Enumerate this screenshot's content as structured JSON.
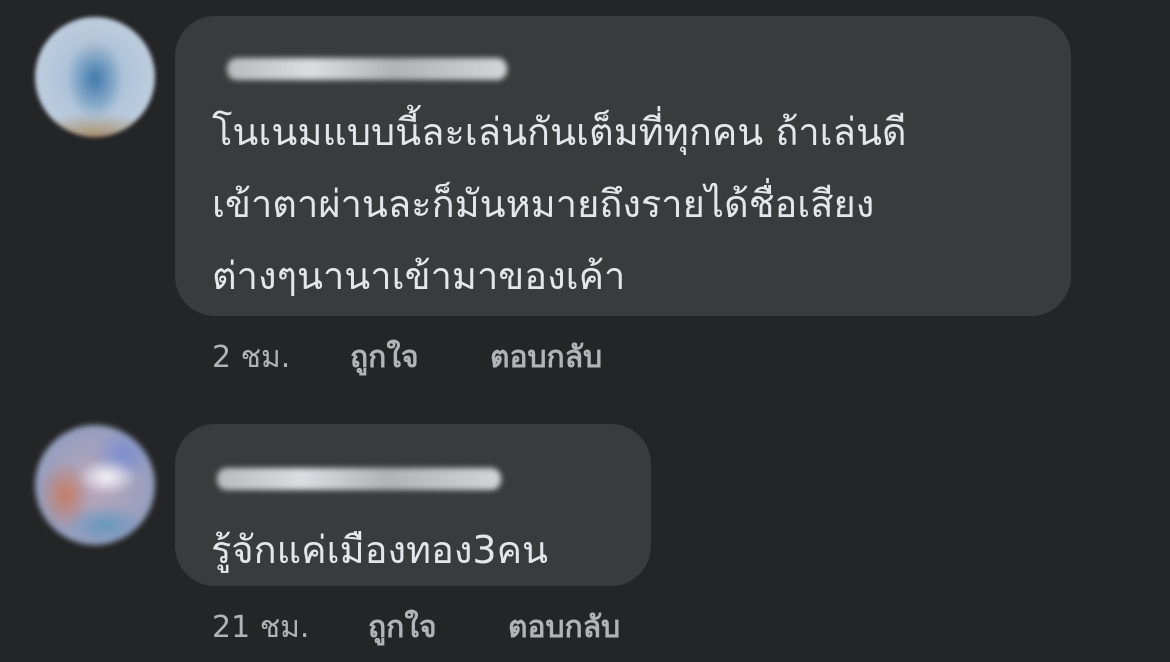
{
  "comments": [
    {
      "lines": [
        "โนเนมแบบนี้ละเล่นกันเต็มที่ทุกคน ถ้าเล่นดี",
        "เข้าตาผ่านละก็มันหมายถึงรายได้ชื่อเสียง",
        "ต่างๆนานาเข้ามาของเค้า"
      ],
      "time": "2 ชม.",
      "like_label": "ถูกใจ",
      "reply_label": "ตอบกลับ"
    },
    {
      "lines": [
        "รู้จักแค่เมืองทอง3คน"
      ],
      "time": "21 ชม.",
      "like_label": "ถูกใจ",
      "reply_label": "ตอบกลับ"
    }
  ]
}
